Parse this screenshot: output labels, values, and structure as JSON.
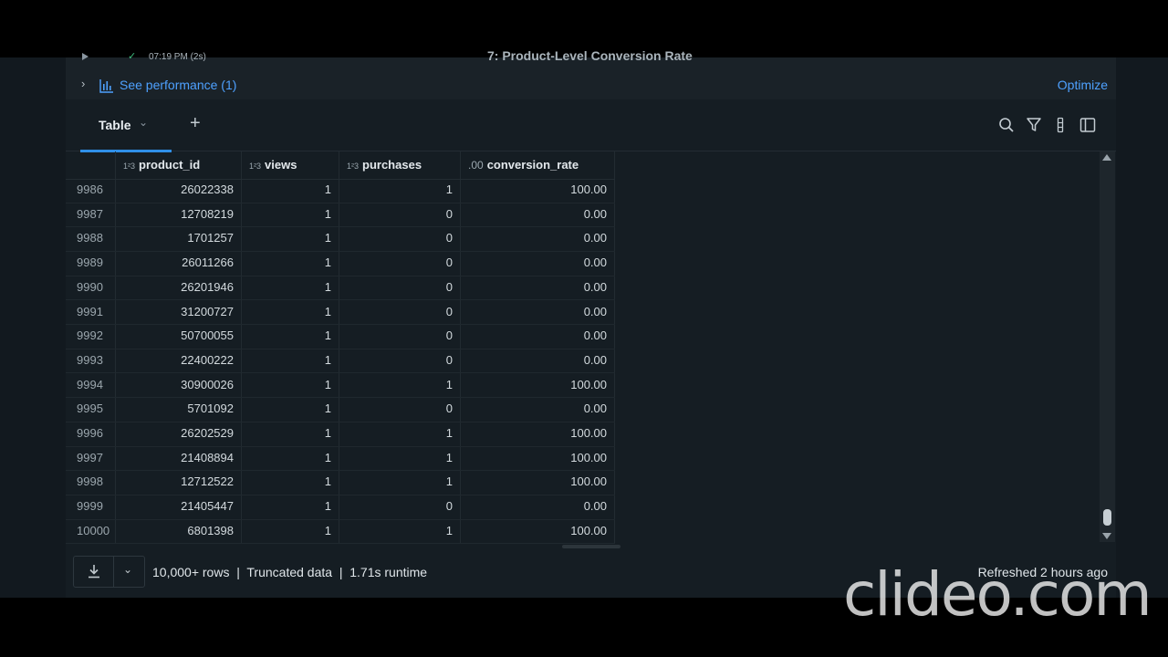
{
  "cell": {
    "time": "07:19 PM (2s)",
    "name": "7: Product-Level Conversion Rate",
    "performance_link": "See performance (1)",
    "optimize_link": "Optimize"
  },
  "tabs": [
    {
      "label": "Table"
    }
  ],
  "columns": [
    {
      "label": "product_id",
      "type_icon": "1²3"
    },
    {
      "label": "views",
      "type_icon": "1²3"
    },
    {
      "label": "purchases",
      "type_icon": "1²3"
    },
    {
      "label": "conversion_rate",
      "type_icon": ".00"
    }
  ],
  "rows": [
    [
      "9986",
      "26022338",
      "1",
      "1",
      "100.00"
    ],
    [
      "9987",
      "12708219",
      "1",
      "0",
      "0.00"
    ],
    [
      "9988",
      "1701257",
      "1",
      "0",
      "0.00"
    ],
    [
      "9989",
      "26011266",
      "1",
      "0",
      "0.00"
    ],
    [
      "9990",
      "26201946",
      "1",
      "0",
      "0.00"
    ],
    [
      "9991",
      "31200727",
      "1",
      "0",
      "0.00"
    ],
    [
      "9992",
      "50700055",
      "1",
      "0",
      "0.00"
    ],
    [
      "9993",
      "22400222",
      "1",
      "0",
      "0.00"
    ],
    [
      "9994",
      "30900026",
      "1",
      "1",
      "100.00"
    ],
    [
      "9995",
      "5701092",
      "1",
      "0",
      "0.00"
    ],
    [
      "9996",
      "26202529",
      "1",
      "1",
      "100.00"
    ],
    [
      "9997",
      "21408894",
      "1",
      "1",
      "100.00"
    ],
    [
      "9998",
      "12712522",
      "1",
      "1",
      "100.00"
    ],
    [
      "9999",
      "21405447",
      "1",
      "0",
      "0.00"
    ],
    [
      "10000",
      "6801398",
      "1",
      "1",
      "100.00"
    ]
  ],
  "footer": {
    "summary": "10,000+ rows  |  Truncated data  |  1.71s runtime",
    "refreshed": "Refreshed 2 hours ago"
  },
  "watermark": "clideo.com",
  "colors": {
    "accent": "#2f8fe8",
    "link": "#4ea1ff",
    "success": "#3fbf7f"
  },
  "icons": [
    "play-icon",
    "check-icon",
    "bar-chart-icon",
    "chevron-right-icon",
    "chevron-down-icon",
    "plus-icon",
    "search-icon",
    "filter-icon",
    "more-vertical-icon",
    "sidebar-panel-icon",
    "download-icon"
  ]
}
